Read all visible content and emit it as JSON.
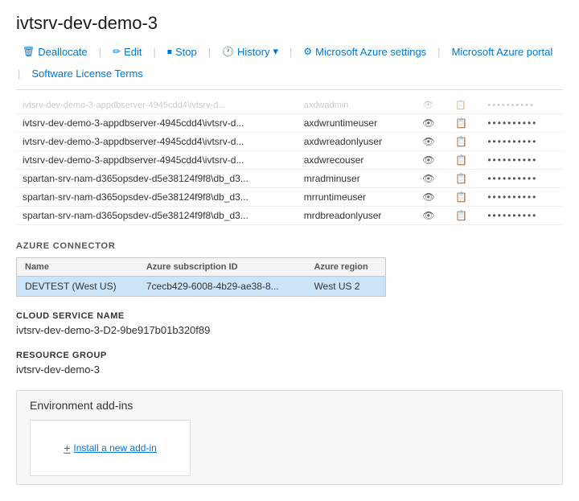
{
  "header": {
    "title": "ivtsrv-dev-demo-3"
  },
  "toolbar": {
    "deallocate_label": "Deallocate",
    "edit_label": "Edit",
    "stop_label": "Stop",
    "history_label": "History",
    "azure_settings_label": "Microsoft Azure settings",
    "azure_portal_label": "Microsoft Azure portal",
    "license_label": "Software License Terms"
  },
  "credentials": [
    {
      "server": "ivtsrv-dev-demo-3-appdbserver-4945cdd4\\ivtsrv-d...",
      "username": "axdwruntimeuser",
      "dots": "••••••••••"
    },
    {
      "server": "ivtsrv-dev-demo-3-appdbserver-4945cdd4\\ivtsrv-d...",
      "username": "axdwreadonlyuser",
      "dots": "••••••••••"
    },
    {
      "server": "ivtsrv-dev-demo-3-appdbserver-4945cdd4\\ivtsrv-d...",
      "username": "axdwrecouser",
      "dots": "••••••••••"
    },
    {
      "server": "spartan-srv-nam-d365opsdev-d5e38124f9f8\\db_d3...",
      "username": "mradminuser",
      "dots": "••••••••••"
    },
    {
      "server": "spartan-srv-nam-d365opsdev-d5e38124f9f8\\db_d3...",
      "username": "mrruntimeuser",
      "dots": "••••••••••"
    },
    {
      "server": "spartan-srv-nam-d365opsdev-d5e38124f9f8\\db_d3...",
      "username": "mrdbreadonlyuser",
      "dots": "••••••••••"
    }
  ],
  "azure_connector": {
    "section_title": "AZURE CONNECTOR",
    "columns": [
      "Name",
      "Azure subscription ID",
      "Azure region"
    ],
    "rows": [
      {
        "name": "DEVTEST (West US)",
        "subscription_id": "7cecb429-6008-4b29-ae38-8...",
        "region": "West US 2",
        "selected": true
      }
    ]
  },
  "cloud_service": {
    "label": "CLOUD SERVICE NAME",
    "value": "ivtsrv-dev-demo-3-D2-9be917b01b320f89"
  },
  "resource_group": {
    "label": "RESOURCE GROUP",
    "value": "ivtsrv-dev-demo-3"
  },
  "env_addins": {
    "title": "Environment add-ins",
    "install_label": "Install a new add-in"
  },
  "faded_row": {
    "server": "ivtsrv-dev-demo-3-appdbserver-4945cdd4\\ivtsrv-d...",
    "username": "axdwadmin",
    "dots": "••••••••••"
  }
}
